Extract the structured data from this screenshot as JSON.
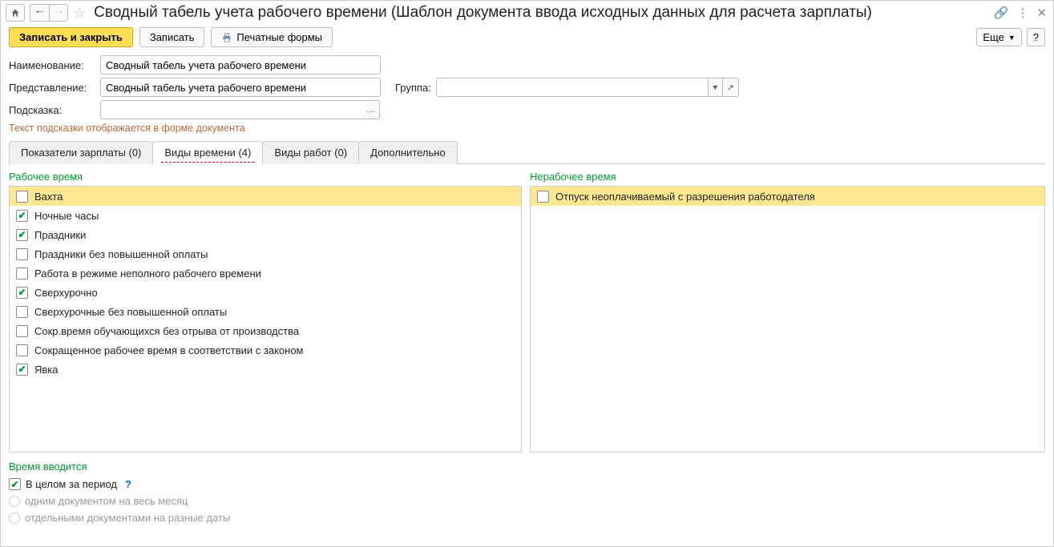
{
  "title": "Сводный табель учета рабочего времени (Шаблон документа ввода исходных данных для расчета зарплаты)",
  "toolbar": {
    "save_close": "Записать и закрыть",
    "save": "Записать",
    "print_forms": "Печатные формы",
    "more": "Еще",
    "help": "?"
  },
  "form": {
    "name_label": "Наименование:",
    "name_value": "Сводный табель учета рабочего времени",
    "repr_label": "Представление:",
    "repr_value": "Сводный табель учета рабочего времени",
    "group_label": "Группа:",
    "group_value": "",
    "hint_label": "Подсказка:",
    "hint_value": "",
    "hint_text": "Текст подсказки отображается в форме документа"
  },
  "tabs": {
    "t0": "Показатели зарплаты (0)",
    "t1": "Виды времени (4)",
    "t2": "Виды работ (0)",
    "t3": "Дополнительно"
  },
  "sections": {
    "work_time": "Рабочее время",
    "nonwork_time": "Нерабочее время",
    "entry": "Время вводится"
  },
  "work_items": [
    {
      "label": "Вахта",
      "checked": false,
      "selected": true
    },
    {
      "label": "Ночные часы",
      "checked": true
    },
    {
      "label": "Праздники",
      "checked": true
    },
    {
      "label": "Праздники без повышенной оплаты",
      "checked": false
    },
    {
      "label": "Работа в режиме неполного рабочего времени",
      "checked": false
    },
    {
      "label": "Сверхурочно",
      "checked": true
    },
    {
      "label": "Сверхурочные без повышенной оплаты",
      "checked": false
    },
    {
      "label": "Сокр.время обучающихся без отрыва от производства",
      "checked": false
    },
    {
      "label": "Сокращенное рабочее время в соответствии с законом",
      "checked": false
    },
    {
      "label": "Явка",
      "checked": true
    }
  ],
  "nonwork_items": [
    {
      "label": "Отпуск неоплачиваемый с разрешения работодателя",
      "checked": false,
      "selected": true
    }
  ],
  "entry": {
    "whole_period": "В целом за период",
    "one_doc": "одним документом на весь месяц",
    "separate_docs": "отдельными документами на разные даты"
  }
}
